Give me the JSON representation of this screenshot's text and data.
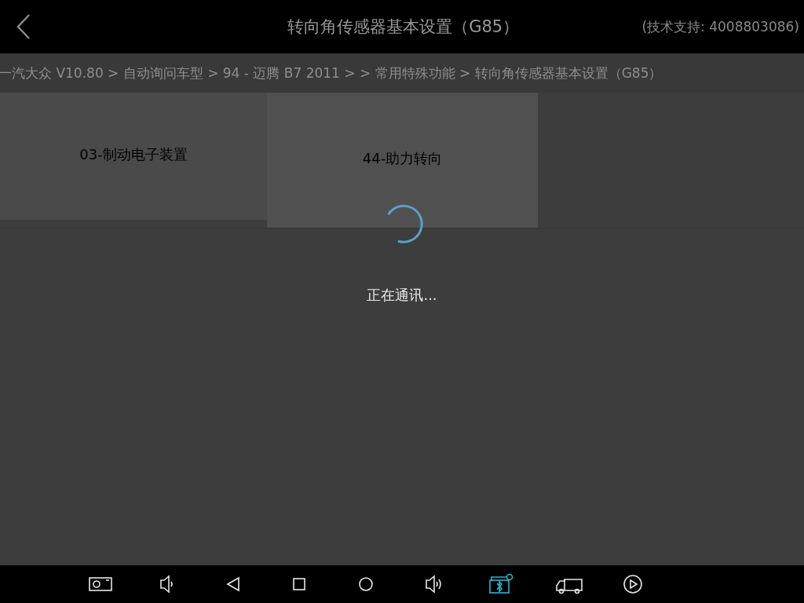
{
  "header": {
    "title": "转向角传感器基本设置（G85）",
    "support": "(技术支持: 4008803086)"
  },
  "breadcrumb": "一汽大众 V10.80 > 自动询问车型 > 94 - 迈腾 B7 2011 > > 常用特殊功能 > 转向角传感器基本设置（G85）",
  "modules": [
    {
      "label": "03-制动电子装置"
    },
    {
      "label": "44-助力转向"
    }
  ],
  "loading": {
    "message": "正在通讯..."
  },
  "nav_bar": [
    {
      "kind": "camera",
      "active": false
    },
    {
      "kind": "volume-down",
      "active": false
    },
    {
      "kind": "back",
      "active": false
    },
    {
      "kind": "recents",
      "active": false
    },
    {
      "kind": "home",
      "active": false
    },
    {
      "kind": "volume-up",
      "active": false
    },
    {
      "kind": "bluetooth",
      "active": true
    },
    {
      "kind": "truck",
      "active": false
    },
    {
      "kind": "play",
      "active": false
    }
  ]
}
